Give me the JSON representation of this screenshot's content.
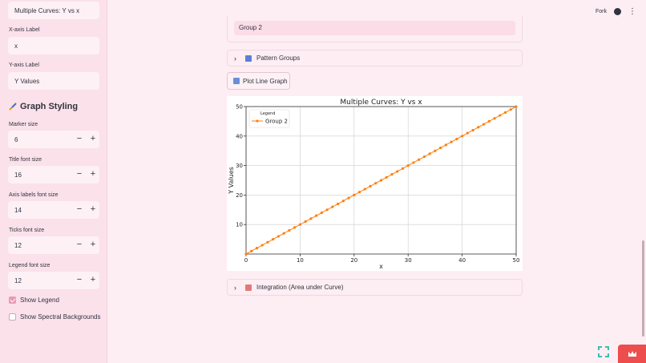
{
  "sidebar": {
    "title_input": "Multiple Curves: Y vs x",
    "xaxis_label_title": "X-axis Label",
    "xaxis_label_value": "x",
    "yaxis_label_title": "Y-axis Label",
    "yaxis_label_value": "Y Values",
    "styling_heading": "Graph Styling",
    "marker_size": {
      "label": "Marker size",
      "value": "6"
    },
    "title_font": {
      "label": "Title font size",
      "value": "16"
    },
    "axis_font": {
      "label": "Axis labels font size",
      "value": "14"
    },
    "ticks_font": {
      "label": "Ticks font size",
      "value": "12"
    },
    "legend_font": {
      "label": "Legend font size",
      "value": "12"
    },
    "show_legend": {
      "label": "Show Legend",
      "checked": true
    },
    "show_spectral": {
      "label": "Show Spectral Backgrounds",
      "checked": false
    },
    "minus": "−",
    "plus": "+"
  },
  "header": {
    "fork": "Fork"
  },
  "main": {
    "group_pill": "Group 2",
    "pattern_groups": "Pattern Groups",
    "plot_button": "Plot Line Graph",
    "integration": "Integration (Area under Curve)",
    "chevron": "›"
  },
  "colors": {
    "accent": "#e89ab7",
    "line": "#ff7f0e",
    "crown": "#ee4d4d"
  },
  "chart_data": {
    "type": "line",
    "title": "Multiple Curves: Y vs x",
    "xlabel": "x",
    "ylabel": "Y Values",
    "xlim": [
      0,
      50
    ],
    "ylim": [
      0,
      50
    ],
    "xticks": [
      0,
      10,
      20,
      30,
      40,
      50
    ],
    "yticks": [
      10,
      20,
      30,
      40,
      50
    ],
    "grid": true,
    "legend": {
      "title": "Legend",
      "position": "top-left"
    },
    "series": [
      {
        "name": "Group 2",
        "x_start": 0,
        "x_end": 50,
        "x_step": 1,
        "y_equals_x": true,
        "color": "#ff7f0e"
      }
    ]
  }
}
